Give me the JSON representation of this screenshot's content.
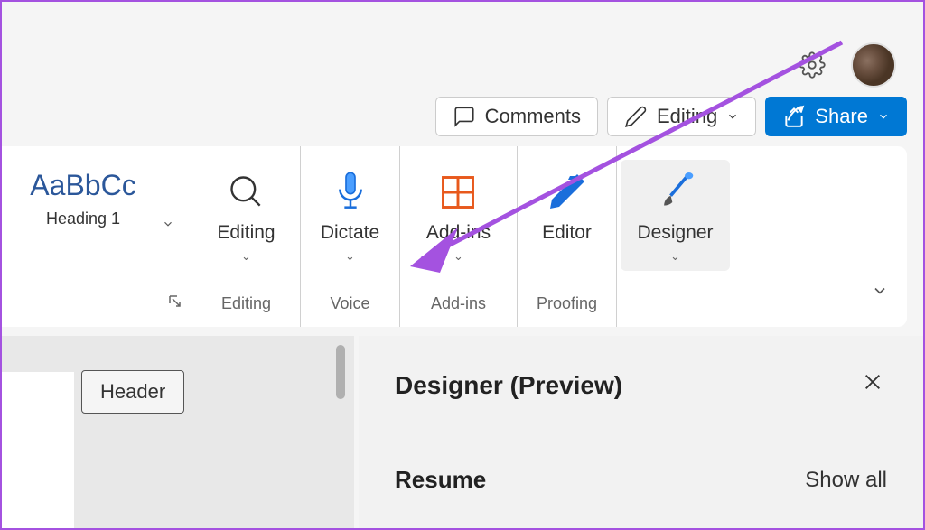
{
  "actions": {
    "comments": "Comments",
    "editing": "Editing",
    "share": "Share"
  },
  "ribbon": {
    "style": {
      "preview": "AaBbCc",
      "name": "Heading 1",
      "group": ""
    },
    "editing": {
      "label": "Editing",
      "group": "Editing"
    },
    "dictate": {
      "label": "Dictate",
      "group": "Voice"
    },
    "addins": {
      "label": "Add-ins",
      "group": "Add-ins"
    },
    "editor": {
      "label": "Editor",
      "group": "Proofing"
    },
    "designer": {
      "label": "Designer",
      "group": ""
    }
  },
  "document": {
    "header_chip": "Header"
  },
  "designer_pane": {
    "title": "Designer (Preview)",
    "section": "Resume",
    "show_all": "Show all"
  }
}
